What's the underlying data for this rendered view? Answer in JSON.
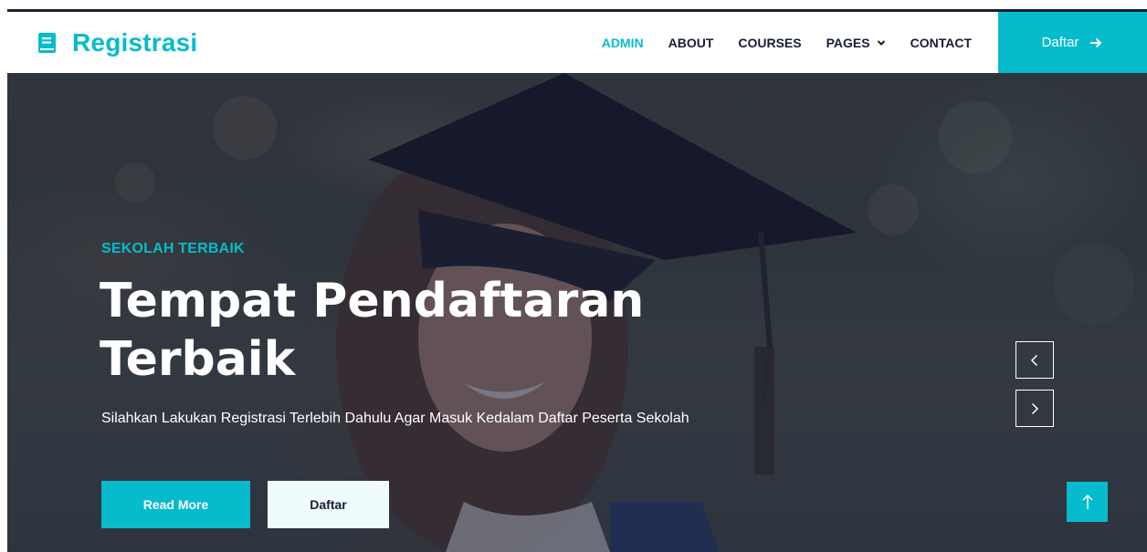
{
  "brand": {
    "name": "Registrasi",
    "icon": "book-icon"
  },
  "nav": {
    "items": [
      {
        "label": "ADMIN",
        "active": true
      },
      {
        "label": "ABOUT",
        "active": false
      },
      {
        "label": "COURSES",
        "active": false
      },
      {
        "label": "PAGES",
        "active": false,
        "dropdown": true
      },
      {
        "label": "CONTACT",
        "active": false
      }
    ],
    "cta_label": "Daftar",
    "cta_icon": "arrow-right-icon"
  },
  "hero": {
    "eyebrow": "SEKOLAH TERBAIK",
    "headline": "Tempat Pendaftaran Terbaik",
    "subtext": "Silahkan Lakukan Registrasi Terlebih Dahulu Agar Masuk Kedalam Daftar Peserta Sekolah",
    "primary_button": "Read More",
    "secondary_button": "Daftar",
    "background": "graduate-photo",
    "carousel_prev_icon": "chevron-left-icon",
    "carousel_next_icon": "chevron-right-icon"
  },
  "back_to_top_icon": "arrow-up-icon",
  "colors": {
    "accent": "#06bbcc",
    "dark": "#181d38",
    "light_button": "#f0fbfc",
    "white": "#ffffff"
  }
}
